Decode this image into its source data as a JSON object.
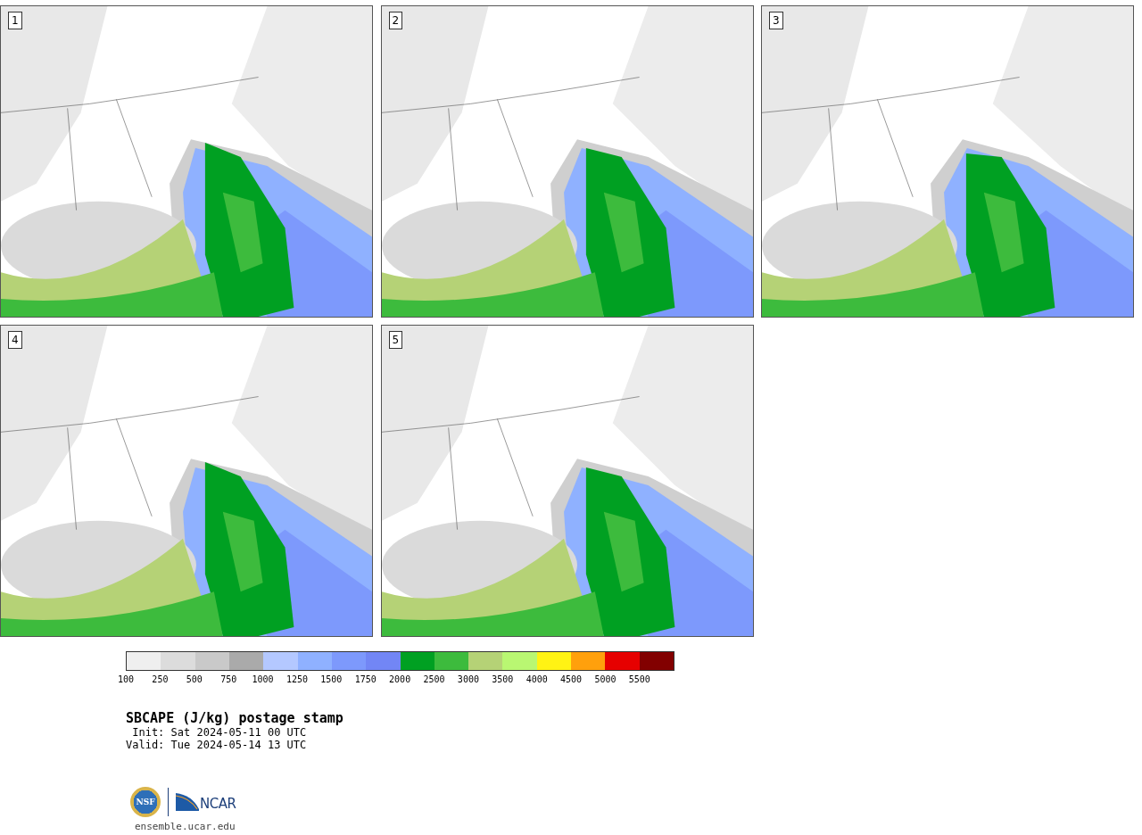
{
  "panels": [
    {
      "label": "1"
    },
    {
      "label": "2"
    },
    {
      "label": "3"
    },
    {
      "label": "4"
    },
    {
      "label": "5"
    }
  ],
  "legend": {
    "segments": [
      {
        "color": "#efefef"
      },
      {
        "color": "#dcdcdc"
      },
      {
        "color": "#c9c9c9"
      },
      {
        "color": "#aaaaaa"
      },
      {
        "color": "#b4c8ff"
      },
      {
        "color": "#8fb1ff"
      },
      {
        "color": "#7d99fc"
      },
      {
        "color": "#7286f5"
      },
      {
        "color": "#00a022"
      },
      {
        "color": "#3dbb3d"
      },
      {
        "color": "#b5d276"
      },
      {
        "color": "#b9f772"
      },
      {
        "color": "#fff314"
      },
      {
        "color": "#ffa00c"
      },
      {
        "color": "#e60000"
      },
      {
        "color": "#820000"
      }
    ],
    "ticks": [
      "100",
      "250",
      "500",
      "750",
      "1000",
      "1250",
      "1500",
      "1750",
      "2000",
      "2500",
      "3000",
      "3500",
      "4000",
      "4500",
      "5000",
      "5500"
    ]
  },
  "title": "SBCAPE (J/kg) postage stamp",
  "init": " Init: Sat 2024-05-11 00 UTC",
  "valid": "Valid: Tue 2024-05-14 13 UTC",
  "logos": {
    "nsf": "NSF",
    "ncar": "NCAR"
  },
  "url": "ensemble.ucar.edu"
}
